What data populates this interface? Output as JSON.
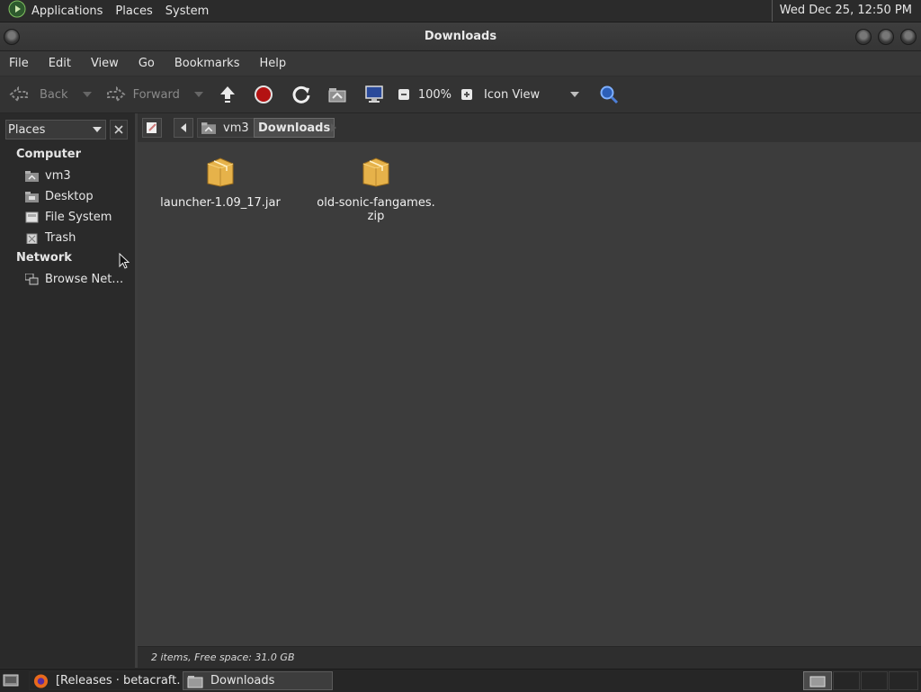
{
  "top_panel": {
    "applications": "Applications",
    "places": "Places",
    "system": "System",
    "clock": "Wed Dec 25, 12:50 PM"
  },
  "window": {
    "title": "Downloads"
  },
  "menubar": {
    "items": [
      "File",
      "Edit",
      "View",
      "Go",
      "Bookmarks",
      "Help"
    ]
  },
  "toolbar": {
    "back": "Back",
    "forward": "Forward",
    "zoom": "100%",
    "view_mode": "Icon View"
  },
  "sidepane": {
    "selector": "Places",
    "sections": {
      "computer": "Computer",
      "network": "Network"
    },
    "computer_items": [
      "vm3",
      "Desktop",
      "File System",
      "Trash"
    ],
    "network_items": [
      "Browse Net…"
    ]
  },
  "pathbar": {
    "crumbs": [
      "vm3",
      "Downloads"
    ]
  },
  "files": [
    {
      "name": "launcher-1.09_17.jar"
    },
    {
      "name": "old-sonic-fangames.",
      "name2": "zip"
    }
  ],
  "statusbar": {
    "text": "2 items, Free space: 31.0 GB"
  },
  "taskbar": {
    "tasks": [
      "[Releases · betacraft…",
      "Downloads"
    ]
  },
  "colors": {
    "accent_folder": "#e6b24a",
    "background": "#3c3c3c"
  }
}
